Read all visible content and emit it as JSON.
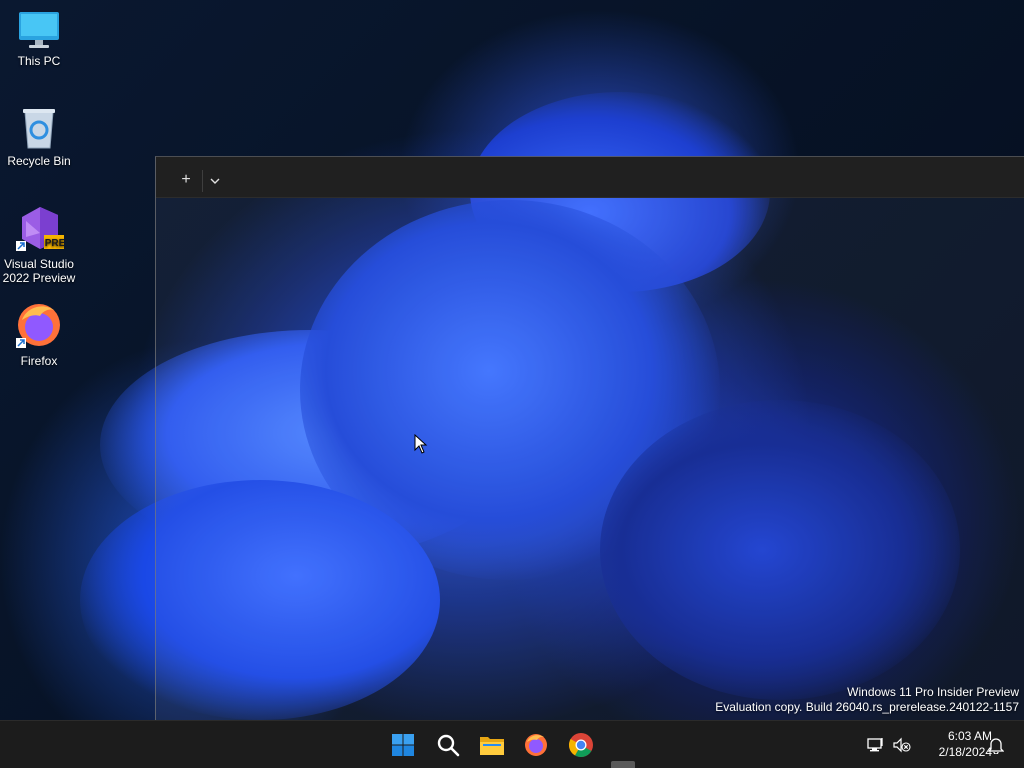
{
  "desktop": {
    "icons": [
      {
        "label": "This PC",
        "icon": "this-pc-icon"
      },
      {
        "label": "Recycle Bin",
        "icon": "recycle-bin-icon"
      },
      {
        "label": "Visual Studio 2022 Preview",
        "icon": "visual-studio-icon",
        "badge": "PRE"
      },
      {
        "label": "Firefox",
        "icon": "firefox-icon"
      }
    ],
    "watermark": {
      "line1": "Windows 11 Pro Insider Preview",
      "line2": "Evaluation copy. Build 26040.rs_prerelease.240122-1157"
    }
  },
  "terminal_window": {
    "new_tab_label": "+",
    "dropdown_label": "⌄"
  },
  "taskbar": {
    "apps": [
      {
        "name": "start",
        "icon": "windows-start-icon"
      },
      {
        "name": "search",
        "icon": "search-icon"
      },
      {
        "name": "file-explorer",
        "icon": "file-explorer-icon"
      },
      {
        "name": "firefox",
        "icon": "firefox-icon"
      },
      {
        "name": "chrome",
        "icon": "chrome-icon"
      }
    ],
    "tray": {
      "network_icon": "network-disconnected-icon",
      "volume_icon": "volume-muted-icon",
      "time": "6:03 AM",
      "date": "2/18/2024",
      "notification_icon": "bell-icon"
    }
  },
  "colors": {
    "taskbar_bg": "#1c1c1c",
    "tabbar_bg": "#202020",
    "wallpaper_accent": "#2f5cff"
  }
}
